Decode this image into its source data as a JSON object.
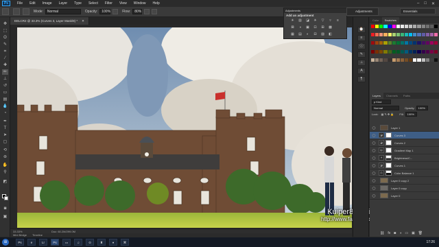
{
  "app": {
    "logo": "Ps"
  },
  "menubar": {
    "items": [
      "File",
      "Edit",
      "Image",
      "Layer",
      "Type",
      "Select",
      "Filter",
      "View",
      "Window",
      "Help"
    ]
  },
  "window_controls": {
    "min": "–",
    "max": "□",
    "close": "✕"
  },
  "options": {
    "mode_label": "Mode:",
    "mode_value": "Normal",
    "opacity_label": "Opacity:",
    "opacity_value": "100%",
    "flow_label": "Flow:",
    "flow_value": "80%"
  },
  "adjustments": {
    "tab": "Adjustments",
    "subtitle": "Add an adjustment",
    "icons": [
      "☀",
      "▥",
      "◪",
      "☀",
      "▽",
      "▿",
      "≡",
      "⊠",
      "◑",
      "▣",
      "⊡",
      "⊞",
      "▩",
      "",
      "▦",
      "▤",
      "◐",
      "⊟",
      "▨",
      "◧"
    ]
  },
  "workspace": {
    "label": "Adjustments",
    "essentials": "Essentials"
  },
  "document": {
    "tab_title": "EELCR2 @ 33.3% (Curves 3, Layer Mask/8) *",
    "close": "✕",
    "zoom": "33.33%",
    "doc_size": "Doc: 60.2M/299.0M"
  },
  "bottom_tabs": [
    "Mini Bridge",
    "Timeline"
  ],
  "watermark": {
    "line1": "Kuiper8 Design Studio",
    "line2": "http://www.facebook.com/Kuiper8"
  },
  "right_panel": {
    "color_tabs": [
      "Color",
      "Swatches"
    ],
    "active_color_tab": "Swatches",
    "swatch_colors": [
      "#ff0000",
      "#ffff00",
      "#00ff00",
      "#00ffff",
      "#0000ff",
      "#ff00ff",
      "#ffffff",
      "#ebebeb",
      "#d6d6d6",
      "#c2c2c2",
      "#adadad",
      "#999999",
      "#858585",
      "#707070",
      "#5c5c5c",
      "#000000",
      "#ee1d24",
      "#f26c4f",
      "#f69679",
      "#fbaf5d",
      "#fff467",
      "#acd372",
      "#7dc473",
      "#3bb878",
      "#1abbb4",
      "#00bff3",
      "#438ccb",
      "#5574b9",
      "#605ca8",
      "#855fa8",
      "#a763a9",
      "#f06ea9",
      "#9e0b0f",
      "#a0410d",
      "#a36209",
      "#aba000",
      "#598527",
      "#1a7b30",
      "#007236",
      "#00746b",
      "#0076a4",
      "#004a80",
      "#003370",
      "#1d1363",
      "#450e61",
      "#62055f",
      "#9e005d",
      "#9d0039",
      "#790000",
      "#7b2e00",
      "#7d4900",
      "#827b00",
      "#406618",
      "#005e20",
      "#005826",
      "#005952",
      "#005b7f",
      "#003562",
      "#002157",
      "#0d004c",
      "#32004b",
      "#4b0049",
      "#7b0046",
      "#7a0026",
      "#c7b299",
      "#998675",
      "#736357",
      "#534741",
      "#37302d",
      "#c69c6d",
      "#a67c52",
      "#8c6239",
      "#754c24",
      "#603913",
      "#ffffff",
      "#f0f0f0",
      "#c0c0c0",
      "#808080",
      "#404040",
      "#101010"
    ],
    "layer_tabs": [
      "Layers",
      "Channels",
      "Paths"
    ],
    "blend_mode": "Normal",
    "opacity_label": "Opacity:",
    "opacity_value": "100%",
    "lock_label": "Lock:",
    "fill_label": "Fill:",
    "fill_value": "100%",
    "layers": [
      {
        "name": "Layer 1",
        "kind": "pixel"
      },
      {
        "name": "Curves 3",
        "kind": "adj",
        "selected": true
      },
      {
        "name": "Curves 2",
        "kind": "adj"
      },
      {
        "name": "Gradient Map 1",
        "kind": "adj"
      },
      {
        "name": "Brightness/C...",
        "kind": "adj"
      },
      {
        "name": "Curves 1",
        "kind": "adj"
      },
      {
        "name": "Color Balance 1",
        "kind": "adj"
      },
      {
        "name": "Layer 0 copy 2",
        "kind": "pixel"
      },
      {
        "name": "Layer 0 copy",
        "kind": "pixel"
      },
      {
        "name": "Layer 0",
        "kind": "pixel"
      }
    ]
  },
  "taskbar": {
    "start": "⊞",
    "apps": [
      "Ps",
      "e",
      "Lr",
      "Ps",
      "▭",
      "♫",
      "⊙",
      "♜",
      "♦",
      "⌘"
    ],
    "clock": "17:26"
  }
}
